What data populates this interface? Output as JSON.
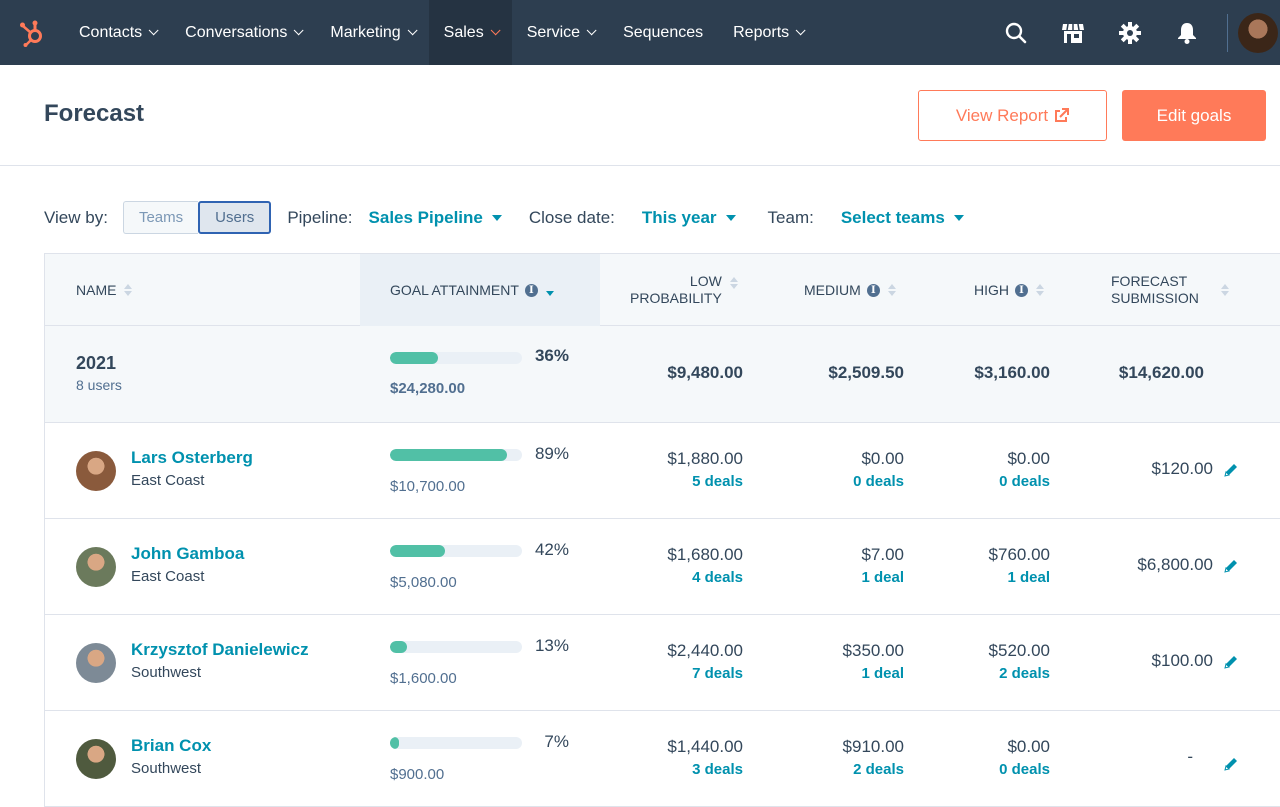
{
  "nav": {
    "logo": "hubspot-sprocket",
    "items": [
      {
        "label": "Contacts",
        "dropdown": true,
        "active": false
      },
      {
        "label": "Conversations",
        "dropdown": true,
        "active": false
      },
      {
        "label": "Marketing",
        "dropdown": true,
        "active": false
      },
      {
        "label": "Sales",
        "dropdown": true,
        "active": true
      },
      {
        "label": "Service",
        "dropdown": true,
        "active": false
      },
      {
        "label": "Sequences",
        "dropdown": false,
        "active": false
      },
      {
        "label": "Reports",
        "dropdown": true,
        "active": false
      }
    ],
    "icons": [
      "search-icon",
      "marketplace-icon",
      "settings-icon",
      "notifications-icon"
    ]
  },
  "header": {
    "title": "Forecast",
    "view_report_label": "View Report",
    "edit_goals_label": "Edit goals"
  },
  "filters": {
    "view_by_label": "View by:",
    "view_by_options": [
      "Teams",
      "Users"
    ],
    "view_by_selected": "Users",
    "pipeline_label": "Pipeline:",
    "pipeline_value": "Sales Pipeline",
    "close_date_label": "Close date:",
    "close_date_value": "This year",
    "team_label": "Team:",
    "team_value": "Select teams"
  },
  "table": {
    "columns": {
      "name": "NAME",
      "goal": "GOAL ATTAINMENT",
      "low_1": "LOW",
      "low_2": "PROBABILITY",
      "medium": "MEDIUM",
      "high": "HIGH",
      "fc_1": "FORECAST",
      "fc_2": "SUBMISSION"
    },
    "summary": {
      "year": "2021",
      "users": "8 users",
      "attainment_pct": "36%",
      "attainment_fraction": 0.36,
      "goal": "$24,280.00",
      "low": "$9,480.00",
      "medium": "$2,509.50",
      "high": "$3,160.00",
      "forecast": "$14,620.00"
    },
    "rows": [
      {
        "name": "Lars Osterberg",
        "team": "East Coast",
        "attainment_pct": "89%",
        "attainment_fraction": 0.89,
        "goal": "$10,700.00",
        "low": "$1,880.00",
        "low_deals": "5 deals",
        "medium": "$0.00",
        "medium_deals": "0 deals",
        "high": "$0.00",
        "high_deals": "0 deals",
        "forecast": "$120.00",
        "avatar_color": "#8a5a3c"
      },
      {
        "name": "John Gamboa",
        "team": "East Coast",
        "attainment_pct": "42%",
        "attainment_fraction": 0.42,
        "goal": "$5,080.00",
        "low": "$1,680.00",
        "low_deals": "4 deals",
        "medium": "$7.00",
        "medium_deals": "1 deal",
        "high": "$760.00",
        "high_deals": "1 deal",
        "forecast": "$6,800.00",
        "avatar_color": "#6b7a5c"
      },
      {
        "name": "Krzysztof Danielewicz",
        "team": "Southwest",
        "attainment_pct": "13%",
        "attainment_fraction": 0.13,
        "goal": "$1,600.00",
        "low": "$2,440.00",
        "low_deals": "7 deals",
        "medium": "$350.00",
        "medium_deals": "1 deal",
        "high": "$520.00",
        "high_deals": "2 deals",
        "forecast": "$100.00",
        "avatar_color": "#7d8a96"
      },
      {
        "name": "Brian Cox",
        "team": "Southwest",
        "attainment_pct": "7%",
        "attainment_fraction": 0.07,
        "goal": "$900.00",
        "low": "$1,440.00",
        "low_deals": "3 deals",
        "medium": "$910.00",
        "medium_deals": "2 deals",
        "high": "$0.00",
        "high_deals": "0 deals",
        "forecast": "-",
        "avatar_color": "#4f5a3e"
      }
    ]
  }
}
